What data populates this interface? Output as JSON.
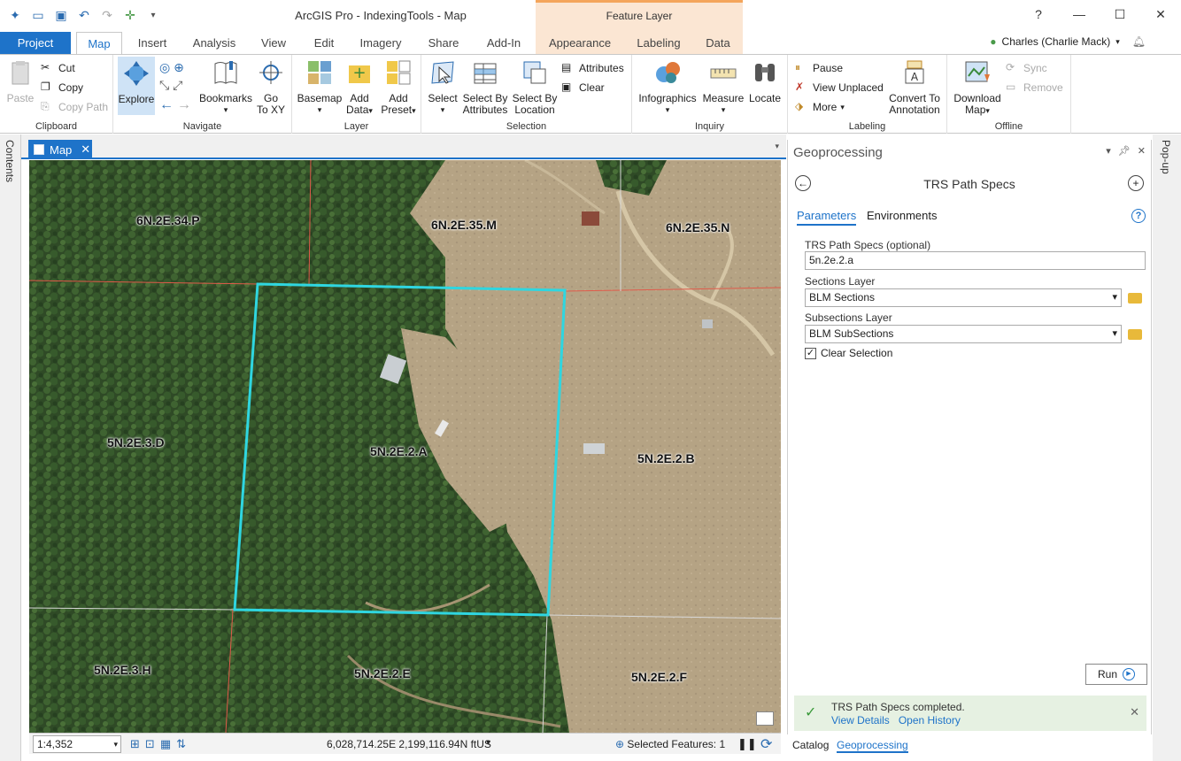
{
  "window": {
    "title": "ArcGIS Pro - IndexingTools - Map",
    "context_tab_group": "Feature Layer",
    "help": "?",
    "minimize": "—",
    "maximize": "☐",
    "close": "✕"
  },
  "tabs": [
    "Project",
    "Map",
    "Insert",
    "Analysis",
    "View",
    "Edit",
    "Imagery",
    "Share",
    "Add-In",
    "Appearance",
    "Labeling",
    "Data"
  ],
  "user": "Charles (Charlie Mack)",
  "ribbon": {
    "clipboard": {
      "label": "Clipboard",
      "paste": "Paste",
      "cut": "Cut",
      "copy": "Copy",
      "copy_path": "Copy Path"
    },
    "navigate": {
      "label": "Navigate",
      "explore": "Explore",
      "bookmarks": "Bookmarks",
      "goto1": "Go",
      "goto2": "To XY"
    },
    "layer": {
      "label": "Layer",
      "basemap": "Basemap",
      "add_data1": "Add",
      "add_data2": "Data",
      "add_preset1": "Add",
      "add_preset2": "Preset"
    },
    "selection": {
      "label": "Selection",
      "select": "Select",
      "sba1": "Select By",
      "sba2": "Attributes",
      "sbl1": "Select By",
      "sbl2": "Location",
      "attributes": "Attributes",
      "clear": "Clear"
    },
    "inquiry": {
      "label": "Inquiry",
      "infographics": "Infographics",
      "measure": "Measure",
      "locate": "Locate"
    },
    "labeling": {
      "label": "Labeling",
      "pause": "Pause",
      "view_unplaced": "View Unplaced",
      "more": "More",
      "conv1": "Convert To",
      "conv2": "Annotation"
    },
    "offline": {
      "label": "Offline",
      "download1": "Download",
      "download2": "Map",
      "sync": "Sync",
      "remove": "Remove"
    }
  },
  "contents_label": "Contents",
  "popup_label": "Pop-up",
  "map": {
    "tab_label": "Map",
    "labels": [
      {
        "text": "6N.2E.34.P"
      },
      {
        "text": "6N.2E.35.M"
      },
      {
        "text": "6N.2E.35.N"
      },
      {
        "text": "5N.2E.3.D"
      },
      {
        "text": "5N.2E.2.A"
      },
      {
        "text": "5N.2E.2.B"
      },
      {
        "text": "5N.2E.3.H"
      },
      {
        "text": "5N.2E.2.E"
      },
      {
        "text": "5N.2E.2.F"
      }
    ],
    "selection_color": "#2fd6e0"
  },
  "statusbar": {
    "scale": "1:4,352",
    "coordinates": "6,028,714.25E 2,199,116.94N ftUS",
    "selected_features": "Selected Features: 1"
  },
  "geoprocessing": {
    "title": "Geoprocessing",
    "tool": "TRS Path Specs",
    "tab_parameters": "Parameters",
    "tab_environments": "Environments",
    "param1_label": "TRS Path Specs (optional)",
    "param1_value": "5n.2e.2.a",
    "param2_label": "Sections Layer",
    "param2_value": "BLM Sections",
    "param3_label": "Subsections Layer",
    "param3_value": "BLM SubSections",
    "clear_selection": "Clear Selection",
    "run": "Run",
    "message": "TRS Path Specs completed.",
    "view_details": "View Details",
    "open_history": "Open History",
    "bottom_tab_catalog": "Catalog",
    "bottom_tab_geoprocessing": "Geoprocessing"
  }
}
